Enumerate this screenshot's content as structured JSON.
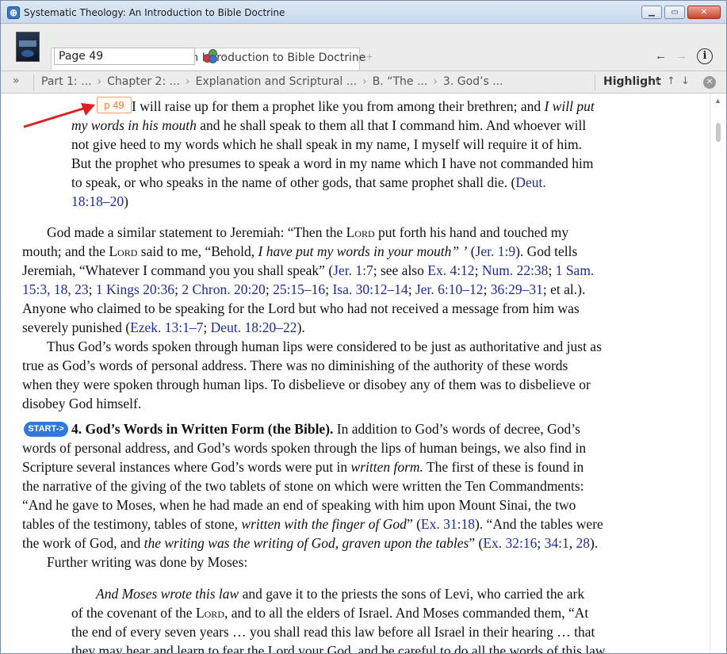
{
  "window": {
    "title": "Systematic Theology: An Introduction to Bible Doctrine",
    "app_icon_glyph": "⊕",
    "minimize": "▁",
    "maximize": "▭",
    "close": "✕"
  },
  "header": {
    "tab_title": "Systematic Theology: An Introduction to Bible Doctrine",
    "tab_add": "+",
    "page_input_value": "Page 49",
    "back_glyph": "←",
    "forward_glyph": "→",
    "info_glyph": "i",
    "sync_caret": "▾"
  },
  "breadcrumb": {
    "toggle": "»",
    "items": [
      "Part 1: ...",
      "Chapter 2: ...",
      "Explanation and Scriptural ...",
      "B. “The ...",
      "3. God’s ..."
    ],
    "separator": "›",
    "highlight_label": "Highlight",
    "highlight_caret": "▾",
    "up": "↑",
    "down": "↓",
    "close": "✕"
  },
  "content": {
    "page_marker": "p 49",
    "start_badge": "START->",
    "block1": {
      "l1": "I will raise up for them a prophet like you from among their brethren; and ",
      "l1_em": "I will put",
      "l2_em": "my words in his mouth",
      "l2": " and he shall speak to them all that I command him. And whoever will",
      "l3": "not give heed to my words which he shall speak in my name, I myself will require it of him.",
      "l4": "But the prophet who presumes to speak a word in my name which I have not commanded him",
      "l5": "to speak, or who speaks in the name of other gods, that same prophet shall die. (",
      "l5_ref": "Deut.",
      "l6_ref": "18:18–20",
      "l6": ")"
    },
    "para2": {
      "l1a": "God made a similar statement to Jeremiah: “Then the ",
      "l1_lord": "Lord",
      "l1b": " put forth his hand and touched my",
      "l2a": "mouth; and the ",
      "l2_lord": "Lord",
      "l2b": " said to me, “Behold, ",
      "l2_em": "I have put my words in your mouth” ’",
      "l2c": " (",
      "l2_ref": "Jer. 1:9",
      "l2d": "). God tells",
      "l3a": "Jeremiah, “Whatever I command you you shall speak” (",
      "l3_ref1": "Jer. 1:7",
      "l3b": "; see also ",
      "l3_ref2": "Ex. 4:12",
      "l3c": "; ",
      "l3_ref3": "Num. 22:38",
      "l3d": "; ",
      "l3_ref4": "1 Sam.",
      "l4_ref1": "15:3, 18, 23",
      "l4a": "; ",
      "l4_ref2": "1 Kings 20:36",
      "l4b": "; ",
      "l4_ref3": "2 Chron. 20:20",
      "l4c": "; ",
      "l4_ref4": "25:15–16",
      "l4d": "; ",
      "l4_ref5": "Isa. 30:12–14",
      "l4e": "; ",
      "l4_ref6": "Jer. 6:10–12",
      "l4f": "; ",
      "l4_ref7": "36:29–31",
      "l4g": "; et al.).",
      "l5": "Anyone who claimed to be speaking for the Lord but who had not received a message from him was",
      "l6a": "severely punished (",
      "l6_ref1": "Ezek. 13:1–7",
      "l6b": "; ",
      "l6_ref2": "Deut. 18:20–22",
      "l6c": ")."
    },
    "para3": {
      "l1": "Thus God’s words spoken through human lips were considered to be just as authoritative and just as",
      "l2": "true as God’s words of personal address. There was no diminishing of the authority of these words",
      "l3": "when they were spoken through human lips. To disbelieve or disobey any of them was to disbelieve or",
      "l4": "disobey God himself."
    },
    "para4": {
      "heading": "4. God’s Words in Written Form (the Bible).",
      "l1": " In addition to God’s words of decree, God’s",
      "l2": "words of personal address, and God’s words spoken through the lips of human beings, we also find in",
      "l3a": "Scripture several instances where God’s words were put in ",
      "l3_em": "written form.",
      "l3b": " The first of these is found in",
      "l4": "the narrative of the giving of the two tablets of stone on which were written the Ten Commandments:",
      "l5": "“And he gave to Moses, when he had made an end of speaking with him upon Mount Sinai, the two",
      "l6a": "tables of the testimony, tables of stone, ",
      "l6_em": "written with the finger of God",
      "l6b": "” (",
      "l6_ref": "Ex. 31:18",
      "l6c": "). “And the tables were",
      "l7a": "the work of God, and ",
      "l7_em": "the writing was the writing of God, graven upon the tables",
      "l7b": "” (",
      "l7_ref1": "Ex. 32:16",
      "l7c": "; ",
      "l7_ref2": "34:1",
      "l7d": ", ",
      "l7_ref3": "28",
      "l7e": ")."
    },
    "para5": "Further writing was done by Moses:",
    "block2": {
      "l1_em": "And Moses wrote this law",
      "l1": " and gave it to the priests the sons of Levi, who carried the ark",
      "l2a": "of the covenant of the ",
      "l2_lord": "Lord",
      "l2b": ", and to all the elders of Israel. And Moses commanded them, “At",
      "l3": "the end of every seven years … you shall read this law before all Israel in their hearing … that",
      "l4": "they may hear and learn to fear the Lord your God, and be careful to do all the words of this law"
    }
  },
  "colors": {
    "reference": "#1c2d8f",
    "page_marker": "#f07b2b",
    "start_badge": "#2f7ad6",
    "arrow": "#e02020"
  }
}
